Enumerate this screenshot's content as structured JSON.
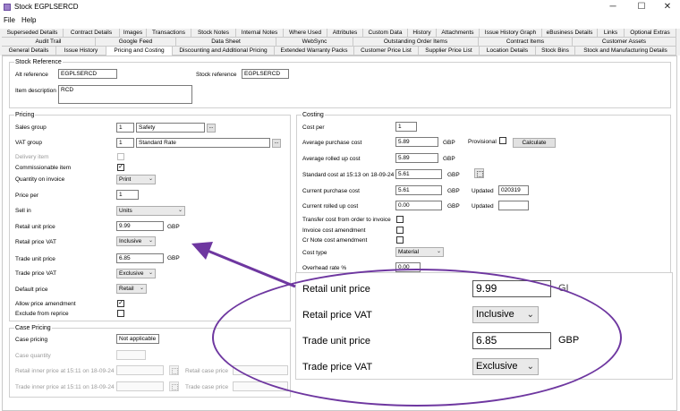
{
  "window": {
    "title": "Stock EGPLSERCD",
    "minimize": "─",
    "maximize": "☐",
    "close": "✕"
  },
  "menu": [
    "File",
    "Help"
  ],
  "tabs_row1": [
    "Superseded Details",
    "Contract Details",
    "Images",
    "Transactions",
    "Stock Notes",
    "Internal Notes",
    "Where Used",
    "Attributes",
    "Custom Data",
    "History",
    "Attachments",
    "Issue History Graph",
    "eBusiness Details",
    "Links",
    "Optional Extras"
  ],
  "tabs_row2": [
    "Audit Trail",
    "Google Feed",
    "Data Sheet",
    "WebSync",
    "Outstanding Order Items",
    "Contract Items",
    "Customer Assets"
  ],
  "tabs_row3": [
    "General Details",
    "Issue History",
    "Pricing and Costing",
    "Discounting and Additional Pricing",
    "Extended Warranty Packs",
    "Customer Price List",
    "Supplier Price List",
    "Location Details",
    "Stock Bins",
    "Stock and Manufacturing Details"
  ],
  "active_tab": "Pricing and Costing",
  "stock_reference": {
    "title": "Stock Reference",
    "alt_reference_label": "Alt reference",
    "alt_reference": "EGPLSERCD",
    "stock_reference_label": "Stock reference",
    "stock_reference": "EGPLSERCD",
    "item_description_label": "Item description",
    "item_description": "RCD"
  },
  "pricing": {
    "title": "Pricing",
    "sales_group_label": "Sales group",
    "sales_group_code": "1",
    "sales_group_name": "Safety",
    "vat_group_label": "VAT group",
    "vat_group_code": "1",
    "vat_group_name": "Standard Rate",
    "delivery_item_label": "Delivery item",
    "commissionable_item_label": "Commissionable item",
    "quantity_on_invoice_label": "Quantity on invoice",
    "quantity_on_invoice": "Print",
    "price_per_label": "Price per",
    "price_per": "1",
    "sell_in_label": "Sell in",
    "sell_in": "Units",
    "retail_unit_price_label": "Retail unit price",
    "retail_unit_price": "9.99",
    "currency": "GBP",
    "retail_price_vat_label": "Retail price VAT",
    "retail_price_vat": "Inclusive",
    "trade_unit_price_label": "Trade unit price",
    "trade_unit_price": "6.85",
    "trade_price_vat_label": "Trade price VAT",
    "trade_price_vat": "Exclusive",
    "default_price_label": "Default price",
    "default_price": "Retail",
    "allow_price_amendment_label": "Allow price amendment",
    "exclude_from_reprice_label": "Exclude from reprice"
  },
  "case_pricing": {
    "title": "Case Pricing",
    "case_pricing_label": "Case pricing",
    "case_pricing": "Not applicable",
    "case_quantity_label": "Case quantity",
    "retail_inner_label": "Retail inner price at 15:11 on 18-09-24",
    "retail_case_label": "Retail case price",
    "trade_inner_label": "Trade inner price at 15:11 on 18-09-24",
    "trade_case_label": "Trade case price"
  },
  "costing": {
    "title": "Costing",
    "cost_per_label": "Cost per",
    "cost_per": "1",
    "average_purchase_cost_label": "Average purchase cost",
    "average_purchase_cost": "5.89",
    "provisional_label": "Provisional",
    "calculate_label": "Calculate",
    "average_rolled_up_cost_label": "Average rolled up cost",
    "average_rolled_up_cost": "5.89",
    "standard_cost_label": "Standard cost at 15:13 on 18-09-24",
    "standard_cost": "5.61",
    "current_purchase_cost_label": "Current purchase cost",
    "current_purchase_cost": "5.61",
    "updated_label": "Updated",
    "updated_1": "020319",
    "current_rolled_up_cost_label": "Current rolled up cost",
    "current_rolled_up_cost": "0.00",
    "transfer_cost_label": "Transfer cost from order to invoice",
    "invoice_cost_amendment_label": "Invoice cost amendment",
    "cr_note_cost_amendment_label": "Cr Note cost amendment",
    "cost_type_label": "Cost type",
    "cost_type": "Material",
    "overhead_rate_label": "Overhead rate %",
    "overhead_rate": "0.00",
    "currency": "GBP"
  },
  "zoom_callout": {
    "retail_unit_price_label": "Retail unit price",
    "retail_unit_price": "9.99",
    "retail_price_vat_label": "Retail price VAT",
    "retail_price_vat": "Inclusive",
    "trade_unit_price_label": "Trade unit price",
    "trade_unit_price": "6.85",
    "trade_price_vat_label": "Trade price VAT",
    "trade_price_vat": "Exclusive",
    "currency_partial": "GI",
    "currency": "GBP"
  },
  "colors": {
    "annotation": "#6e37a0",
    "tab_bg": "#f0f0f0",
    "border": "#c9c9c9"
  }
}
